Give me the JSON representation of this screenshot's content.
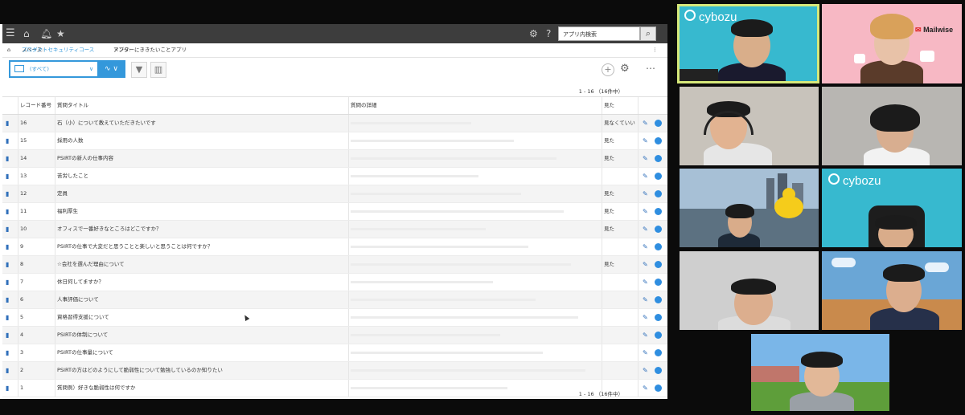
{
  "app": {
    "search_placeholder": "アプリ内検索",
    "breadcrumb": {
      "space_prefix": "スペース: ",
      "space_name": "プロダクトセキュリティコース",
      "app_prefix": "アプリ: ",
      "app_name": "メンターにききたいことアプリ"
    },
    "view_label": "(すべて)",
    "pager": "1 - 16 （16件中）",
    "columns": [
      "レコード番号",
      "質問タイトル",
      "質問の詳細",
      "見た"
    ],
    "rows": [
      {
        "num": "16",
        "title": "石（小）について教えていただきたいです",
        "seen": "見なくていい"
      },
      {
        "num": "15",
        "title": "採用の人数",
        "seen": "見た"
      },
      {
        "num": "14",
        "title": "PSIRTの新人の仕事内容",
        "seen": "見た"
      },
      {
        "num": "13",
        "title": "苦労したこと",
        "seen": ""
      },
      {
        "num": "12",
        "title": "定員",
        "seen": "見た"
      },
      {
        "num": "11",
        "title": "福利厚生",
        "seen": "見た"
      },
      {
        "num": "10",
        "title": "オフィスで一番好きなところはどこですか？",
        "seen": "見た"
      },
      {
        "num": "9",
        "title": "PSIRTの仕事で大変だと思うことと楽しいと思うことは何ですか？",
        "seen": ""
      },
      {
        "num": "8",
        "title": "☆会社を選んだ理由について",
        "seen": "見た"
      },
      {
        "num": "7",
        "title": "休日何してますか？",
        "seen": ""
      },
      {
        "num": "6",
        "title": "人事評価について",
        "seen": ""
      },
      {
        "num": "5",
        "title": "資格習得支援について",
        "seen": ""
      },
      {
        "num": "4",
        "title": "PSIRTの体制について",
        "seen": ""
      },
      {
        "num": "3",
        "title": "PSIRTの仕事量について",
        "seen": ""
      },
      {
        "num": "2",
        "title": "PSIRTの方はどのようにして脆弱性について勉強しているのか知りたい",
        "seen": ""
      },
      {
        "num": "1",
        "title": "質問例）好きな脆弱性は何ですか",
        "seen": ""
      }
    ]
  },
  "video": {
    "brand_cybozu": "cybozu",
    "brand_mailwise": "Mailwise",
    "brand_mailwise_small": "メールワイズ",
    "active_speaker_color": "#d6e87a",
    "accent_blue": "#3498db"
  }
}
